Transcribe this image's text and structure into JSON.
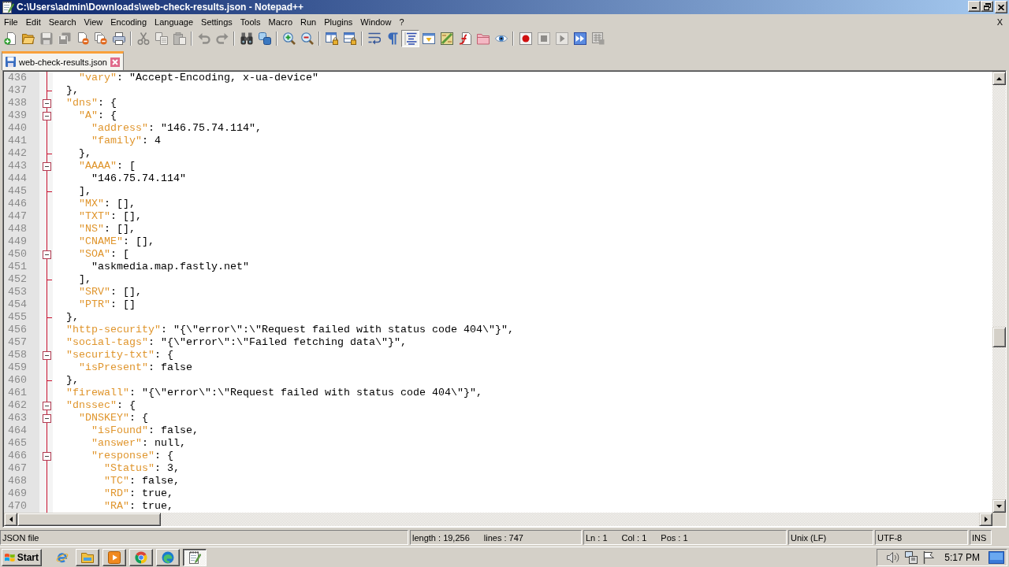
{
  "window": {
    "title": "C:\\Users\\admin\\Downloads\\web-check-results.json - Notepad++"
  },
  "menu": {
    "items": [
      "File",
      "Edit",
      "Search",
      "View",
      "Encoding",
      "Language",
      "Settings",
      "Tools",
      "Macro",
      "Run",
      "Plugins",
      "Window",
      "?"
    ],
    "close_document": "X"
  },
  "toolbar": [
    {
      "buttons": [
        {
          "kind": "new",
          "pressed": false,
          "disabled": false
        },
        {
          "kind": "open",
          "pressed": false,
          "disabled": false
        },
        {
          "kind": "save",
          "pressed": false,
          "disabled": true
        },
        {
          "kind": "saveall",
          "pressed": false,
          "disabled": true
        },
        {
          "kind": "close",
          "pressed": false,
          "disabled": false
        },
        {
          "kind": "closeall",
          "pressed": false,
          "disabled": false
        },
        {
          "kind": "print",
          "pressed": false,
          "disabled": false
        }
      ]
    },
    {
      "buttons": [
        {
          "kind": "cut",
          "pressed": false,
          "disabled": true
        },
        {
          "kind": "copy",
          "pressed": false,
          "disabled": true
        },
        {
          "kind": "paste",
          "pressed": false,
          "disabled": true
        }
      ]
    },
    {
      "buttons": [
        {
          "kind": "undo",
          "pressed": false,
          "disabled": true
        },
        {
          "kind": "redo",
          "pressed": false,
          "disabled": true
        }
      ]
    },
    {
      "buttons": [
        {
          "kind": "find",
          "pressed": false,
          "disabled": false
        },
        {
          "kind": "replace",
          "pressed": false,
          "disabled": false
        }
      ]
    },
    {
      "buttons": [
        {
          "kind": "zoomin",
          "pressed": false,
          "disabled": false
        },
        {
          "kind": "zoomout",
          "pressed": false,
          "disabled": false
        }
      ]
    },
    {
      "buttons": [
        {
          "kind": "syncv",
          "pressed": false,
          "disabled": false
        },
        {
          "kind": "synch",
          "pressed": false,
          "disabled": false
        }
      ]
    },
    {
      "buttons": [
        {
          "kind": "wrap",
          "pressed": false,
          "disabled": false
        },
        {
          "kind": "allchars",
          "pressed": false,
          "disabled": false
        },
        {
          "kind": "indent",
          "pressed": true,
          "disabled": false
        },
        {
          "kind": "udl",
          "pressed": false,
          "disabled": false
        },
        {
          "kind": "docmap",
          "pressed": false,
          "disabled": false
        },
        {
          "kind": "funclist",
          "pressed": false,
          "disabled": false
        },
        {
          "kind": "workspace",
          "pressed": false,
          "disabled": false
        },
        {
          "kind": "monitor",
          "pressed": false,
          "disabled": false
        }
      ]
    },
    {
      "buttons": [
        {
          "kind": "record",
          "pressed": false,
          "disabled": false
        },
        {
          "kind": "stop",
          "pressed": false,
          "disabled": true
        },
        {
          "kind": "play",
          "pressed": false,
          "disabled": true
        },
        {
          "kind": "playmulti",
          "pressed": false,
          "disabled": false
        },
        {
          "kind": "savemacro",
          "pressed": false,
          "disabled": true
        }
      ]
    }
  ],
  "tabs": [
    {
      "label": "web-check-results.json",
      "selected": true,
      "modified": false
    }
  ],
  "editor": {
    "lines": [
      {
        "number": "436",
        "kind": "plain",
        "segments": [
          {
            "kind": "key",
            "text": "    \"vary\""
          },
          {
            "kind": "plain",
            "text": ": \"Accept-Encoding, x-ua-device\""
          }
        ]
      },
      {
        "number": "437",
        "kind": "foldend",
        "segments": [
          {
            "kind": "plain",
            "text": "  },"
          }
        ]
      },
      {
        "number": "438",
        "kind": "foldstart",
        "segments": [
          {
            "kind": "key",
            "text": "  \"dns\""
          },
          {
            "kind": "plain",
            "text": ": {"
          }
        ]
      },
      {
        "number": "439",
        "kind": "foldstart",
        "segments": [
          {
            "kind": "key",
            "text": "    \"A\""
          },
          {
            "kind": "plain",
            "text": ": {"
          }
        ]
      },
      {
        "number": "440",
        "kind": "plain",
        "segments": [
          {
            "kind": "key",
            "text": "      \"address\""
          },
          {
            "kind": "plain",
            "text": ": \"146.75.74.114\","
          }
        ]
      },
      {
        "number": "441",
        "kind": "plain",
        "segments": [
          {
            "kind": "key",
            "text": "      \"family\""
          },
          {
            "kind": "plain",
            "text": ": 4"
          }
        ]
      },
      {
        "number": "442",
        "kind": "foldend",
        "segments": [
          {
            "kind": "plain",
            "text": "    },"
          }
        ]
      },
      {
        "number": "443",
        "kind": "foldstart",
        "segments": [
          {
            "kind": "key",
            "text": "    \"AAAA\""
          },
          {
            "kind": "plain",
            "text": ": ["
          }
        ]
      },
      {
        "number": "444",
        "kind": "plain",
        "segments": [
          {
            "kind": "plain",
            "text": "      \"146.75.74.114\""
          }
        ]
      },
      {
        "number": "445",
        "kind": "foldend",
        "segments": [
          {
            "kind": "plain",
            "text": "    ],"
          }
        ]
      },
      {
        "number": "446",
        "kind": "plain",
        "segments": [
          {
            "kind": "key",
            "text": "    \"MX\""
          },
          {
            "kind": "plain",
            "text": ": [],"
          }
        ]
      },
      {
        "number": "447",
        "kind": "plain",
        "segments": [
          {
            "kind": "key",
            "text": "    \"TXT\""
          },
          {
            "kind": "plain",
            "text": ": [],"
          }
        ]
      },
      {
        "number": "448",
        "kind": "plain",
        "segments": [
          {
            "kind": "key",
            "text": "    \"NS\""
          },
          {
            "kind": "plain",
            "text": ": [],"
          }
        ]
      },
      {
        "number": "449",
        "kind": "plain",
        "segments": [
          {
            "kind": "key",
            "text": "    \"CNAME\""
          },
          {
            "kind": "plain",
            "text": ": [],"
          }
        ]
      },
      {
        "number": "450",
        "kind": "foldstart",
        "segments": [
          {
            "kind": "key",
            "text": "    \"SOA\""
          },
          {
            "kind": "plain",
            "text": ": ["
          }
        ]
      },
      {
        "number": "451",
        "kind": "plain",
        "segments": [
          {
            "kind": "plain",
            "text": "      \"askmedia.map.fastly.net\""
          }
        ]
      },
      {
        "number": "452",
        "kind": "foldend",
        "segments": [
          {
            "kind": "plain",
            "text": "    ],"
          }
        ]
      },
      {
        "number": "453",
        "kind": "plain",
        "segments": [
          {
            "kind": "key",
            "text": "    \"SRV\""
          },
          {
            "kind": "plain",
            "text": ": [],"
          }
        ]
      },
      {
        "number": "454",
        "kind": "plain",
        "segments": [
          {
            "kind": "key",
            "text": "    \"PTR\""
          },
          {
            "kind": "plain",
            "text": ": []"
          }
        ]
      },
      {
        "number": "455",
        "kind": "foldend",
        "segments": [
          {
            "kind": "plain",
            "text": "  },"
          }
        ]
      },
      {
        "number": "456",
        "kind": "plain",
        "segments": [
          {
            "kind": "key",
            "text": "  \"http-security\""
          },
          {
            "kind": "plain",
            "text": ": \"{\\\"error\\\":\\\"Request failed with status code 404\\\"}\","
          }
        ]
      },
      {
        "number": "457",
        "kind": "plain",
        "segments": [
          {
            "kind": "key",
            "text": "  \"social-tags\""
          },
          {
            "kind": "plain",
            "text": ": \"{\\\"error\\\":\\\"Failed fetching data\\\"}\","
          }
        ]
      },
      {
        "number": "458",
        "kind": "foldstart",
        "segments": [
          {
            "kind": "key",
            "text": "  \"security-txt\""
          },
          {
            "kind": "plain",
            "text": ": {"
          }
        ]
      },
      {
        "number": "459",
        "kind": "plain",
        "segments": [
          {
            "kind": "key",
            "text": "    \"isPresent\""
          },
          {
            "kind": "plain",
            "text": ": false"
          }
        ]
      },
      {
        "number": "460",
        "kind": "foldend",
        "segments": [
          {
            "kind": "plain",
            "text": "  },"
          }
        ]
      },
      {
        "number": "461",
        "kind": "plain",
        "segments": [
          {
            "kind": "key",
            "text": "  \"firewall\""
          },
          {
            "kind": "plain",
            "text": ": \"{\\\"error\\\":\\\"Request failed with status code 404\\\"}\","
          }
        ]
      },
      {
        "number": "462",
        "kind": "foldstart",
        "segments": [
          {
            "kind": "key",
            "text": "  \"dnssec\""
          },
          {
            "kind": "plain",
            "text": ": {"
          }
        ]
      },
      {
        "number": "463",
        "kind": "foldstart",
        "segments": [
          {
            "kind": "key",
            "text": "    \"DNSKEY\""
          },
          {
            "kind": "plain",
            "text": ": {"
          }
        ]
      },
      {
        "number": "464",
        "kind": "plain",
        "segments": [
          {
            "kind": "key",
            "text": "      \"isFound\""
          },
          {
            "kind": "plain",
            "text": ": false,"
          }
        ]
      },
      {
        "number": "465",
        "kind": "plain",
        "segments": [
          {
            "kind": "key",
            "text": "      \"answer\""
          },
          {
            "kind": "plain",
            "text": ": null,"
          }
        ]
      },
      {
        "number": "466",
        "kind": "foldstart",
        "segments": [
          {
            "kind": "key",
            "text": "      \"response\""
          },
          {
            "kind": "plain",
            "text": ": {"
          }
        ]
      },
      {
        "number": "467",
        "kind": "plain",
        "segments": [
          {
            "kind": "key",
            "text": "        \"Status\""
          },
          {
            "kind": "plain",
            "text": ": 3,"
          }
        ]
      },
      {
        "number": "468",
        "kind": "plain",
        "segments": [
          {
            "kind": "key",
            "text": "        \"TC\""
          },
          {
            "kind": "plain",
            "text": ": false,"
          }
        ]
      },
      {
        "number": "469",
        "kind": "plain",
        "segments": [
          {
            "kind": "key",
            "text": "        \"RD\""
          },
          {
            "kind": "plain",
            "text": ": true,"
          }
        ]
      },
      {
        "number": "470",
        "kind": "plain",
        "segments": [
          {
            "kind": "key",
            "text": "        \"RA\""
          },
          {
            "kind": "plain",
            "text": ": true,"
          }
        ]
      }
    ]
  },
  "status_bar": {
    "file_type": "JSON file",
    "length": "length : 19,256",
    "lines": "lines : 747",
    "line": "Ln : 1",
    "column": "Col : 1",
    "position": "Pos : 1",
    "line_ending": "Unix (LF)",
    "encoding": "UTF-8",
    "mode": "INS"
  },
  "taskbar": {
    "start_label": "Start",
    "apps": [
      {
        "kind": "folder",
        "selected": false
      },
      {
        "kind": "media",
        "selected": false
      },
      {
        "kind": "chrome",
        "selected": false
      },
      {
        "kind": "edge",
        "selected": false
      },
      {
        "kind": "notepad",
        "selected": true
      }
    ],
    "clock": "5:17 PM"
  }
}
